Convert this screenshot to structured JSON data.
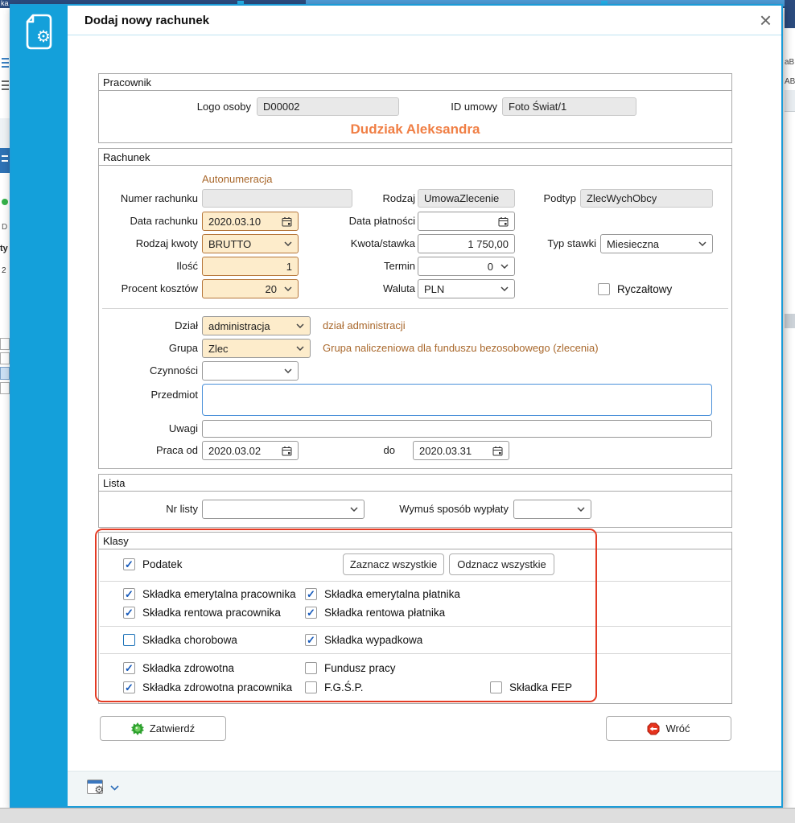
{
  "window": {
    "title": "Dodaj nowy rachunek",
    "close_glyph": "×"
  },
  "background": {
    "top_left_text": "ka",
    "left_text_1": "D",
    "left_text_2": "ty",
    "left_text_3": "2",
    "right_text_1": "aB",
    "right_text_2": "AB"
  },
  "pracownik": {
    "section_title": "Pracownik",
    "logo_label": "Logo osoby",
    "logo_value": "D00002",
    "id_label": "ID umowy",
    "id_value": "Foto Świat/1",
    "person_name": "Dudziak Aleksandra"
  },
  "rachunek": {
    "section_title": "Rachunek",
    "autonumeracja": "Autonumeracja",
    "numer_label": "Numer rachunku",
    "numer_value": "",
    "rodzaj_label": "Rodzaj",
    "rodzaj_value": "UmowaZlecenie",
    "podtyp_label": "Podtyp",
    "podtyp_value": "ZlecWychObcy",
    "data_rachunku_label": "Data rachunku",
    "data_rachunku_value": "2020.03.10",
    "data_platnosci_label": "Data płatności",
    "data_platnosci_value": "",
    "rodzaj_kwoty_label": "Rodzaj kwoty",
    "rodzaj_kwoty_value": "BRUTTO",
    "kwota_label": "Kwota/stawka",
    "kwota_value": "1 750,00",
    "typ_stawki_label": "Typ stawki",
    "typ_stawki_value": "Miesieczna",
    "ilosc_label": "Ilość",
    "ilosc_value": "1",
    "termin_label": "Termin",
    "termin_value": "0",
    "procent_label": "Procent kosztów",
    "procent_value": "20",
    "waluta_label": "Waluta",
    "waluta_value": "PLN",
    "ryczaltowy": {
      "label": "Ryczałtowy",
      "checked": false
    },
    "dzial_label": "Dział",
    "dzial_value": "administracja",
    "dzial_hint": "dział administracji",
    "grupa_label": "Grupa",
    "grupa_value": "Zlec",
    "grupa_hint": "Grupa naliczeniowa dla funduszu bezosobowego (zlecenia)",
    "czynnosci_label": "Czynności",
    "czynnosci_value": "",
    "przedmiot_label": "Przedmiot",
    "przedmiot_value": "",
    "uwagi_label": "Uwagi",
    "uwagi_value": "",
    "praca_od_label": "Praca od",
    "praca_od_value": "2020.03.02",
    "do_label": "do",
    "do_value": "2020.03.31"
  },
  "lista": {
    "section_title": "Lista",
    "nr_listy_label": "Nr listy",
    "nr_listy_value": "",
    "wymus_label": "Wymuś sposób wypłaty",
    "wymus_value": ""
  },
  "klasy": {
    "section_title": "Klasy",
    "select_all_label": "Zaznacz wszystkie",
    "deselect_all_label": "Odznacz wszystkie",
    "podatek": {
      "label": "Podatek",
      "checked": true
    },
    "emerytalna_pracownika": {
      "label": "Składka emerytalna pracownika",
      "checked": true
    },
    "emerytalna_platnika": {
      "label": "Składka emerytalna płatnika",
      "checked": true
    },
    "rentowa_pracownika": {
      "label": "Składka rentowa pracownika",
      "checked": true
    },
    "rentowa_platnika": {
      "label": "Składka rentowa płatnika",
      "checked": true
    },
    "chorobowa": {
      "label": "Składka chorobowa",
      "checked": false
    },
    "wypadkowa": {
      "label": "Składka wypadkowa",
      "checked": true
    },
    "zdrowotna": {
      "label": "Składka zdrowotna",
      "checked": true
    },
    "fundusz_pracy": {
      "label": "Fundusz pracy",
      "checked": false
    },
    "zdrowotna_pracownika": {
      "label": "Składka zdrowotna pracownika",
      "checked": true
    },
    "fgsp": {
      "label": "F.G.Ś.P.",
      "checked": false
    },
    "fep": {
      "label": "Składka FEP",
      "checked": false
    }
  },
  "actions": {
    "submit_label": "Zatwierdź",
    "back_label": "Wróć"
  },
  "colors": {
    "accent_blue": "#14a0da",
    "modal_border": "#1b9cd8",
    "highlight_red": "#e43b24",
    "person_orange": "#f07f45",
    "hint_brown": "#a9682c",
    "peach_field": "#fdeccb",
    "check_blue": "#1458ba"
  }
}
